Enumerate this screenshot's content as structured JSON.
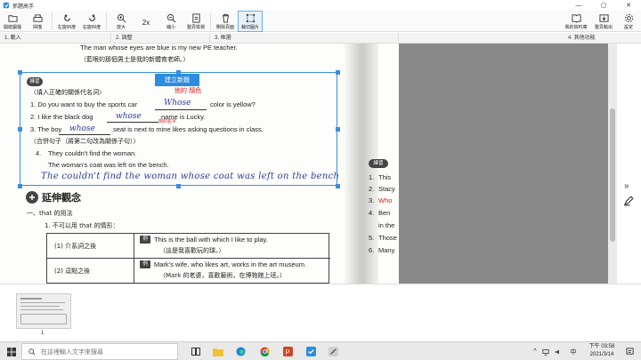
{
  "app": {
    "title": "抓題高手",
    "accent": "#2d8ce0"
  },
  "window_controls": [
    "minimize-icon",
    "maximize-icon",
    "close-icon"
  ],
  "toolbar": {
    "open_file": "開啟圖檔",
    "scan": "掃描",
    "rotate_left": "左旋90度",
    "rotate_right": "右旋90度",
    "zoom_in": "放大",
    "zoom_level": "2x",
    "zoom_out": "縮小",
    "fit_width": "整頁檢視",
    "delete_page": "刪除頁面",
    "crop_image": "裁切圖片",
    "my_bank": "我的資料庫",
    "export": "整頁輸出",
    "settings": "設定"
  },
  "steps": [
    "1. 載入",
    "2. 調整",
    "3. 框選",
    "4. 其他功能"
  ],
  "document": {
    "top_line_en": "The man whose eyes are blue is my new PE teacher.",
    "top_line_zh": "（藍眼的那個男士是我的新體育老師。）",
    "new_question_button": "建立新題",
    "section_badge": "練習",
    "instruction_1": "〈填入正確的關係代名詞〉",
    "red_note": "他的  顏色",
    "q1": "1. Do you want to buy the sports car",
    "q1_end": "color is yellow?",
    "q1_answer": "Whose",
    "q2": "2. I like the black dog",
    "q2_end": "name is Lucky.",
    "q2_answer": "whose",
    "q2_red": "狗的名字",
    "q3": "3. The boy",
    "q3_end": "seat is next to mine likes asking questions in class.",
    "q3_answer": "whose",
    "instruction_2": "〈合併句子（將第二句改為關係子句）〉",
    "q4_a": "They couldn't find the woman.",
    "q4_b": "The woman's coat was left on the bench.",
    "q4_answer": "The couldn't find the woman whose coat was left on the bench",
    "extension_title": "延伸觀念",
    "ext_item": "一、that 的用法",
    "ext_sub": "1. 不可以用 that 的情形：",
    "table": [
      {
        "label": "(1)  介系詞之後",
        "badge": "例",
        "en": "This is the ball with which I like to play.",
        "zh": "（這是我喜歡玩的球。）"
      },
      {
        "label": "(2)  逗點之後",
        "badge": "例",
        "en": "Mark's wife, who likes art, works in the art museum.",
        "zh": "（Mark 的老婆，喜歡藝術，在博物館上班。）"
      }
    ],
    "page2_lines": [
      "This",
      "Stacy",
      "Who",
      "Ben",
      "in the",
      "Those",
      "Many"
    ],
    "page2_nums": [
      "1.",
      "2.",
      "3.",
      "4.",
      "",
      "5.",
      "6."
    ],
    "page2_badge": "練習"
  },
  "thumbnails": [
    {
      "number": "1"
    }
  ],
  "taskbar": {
    "search_placeholder": "在這裡輸入文字來搜尋",
    "time": "下午 03:58",
    "date": "2021/3/14"
  }
}
